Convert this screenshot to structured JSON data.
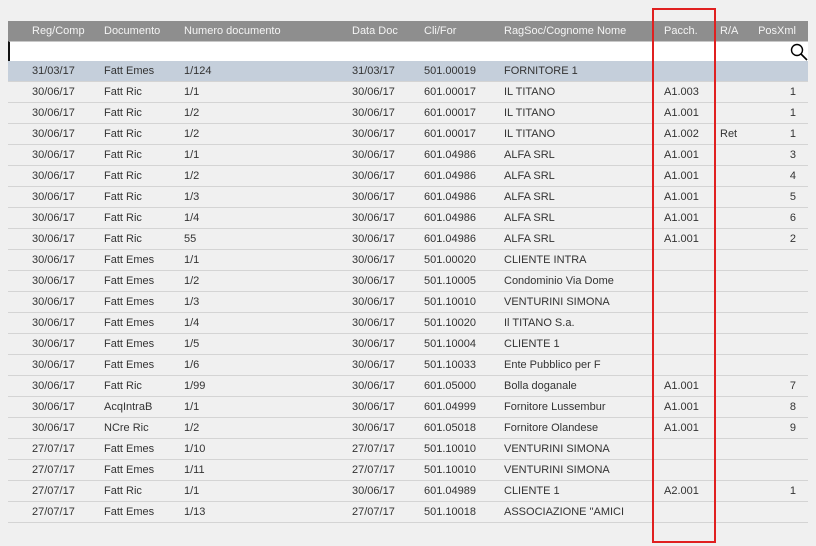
{
  "columns": [
    "Reg/Comp",
    "Documento",
    "Numero documento",
    "Data Doc",
    "Cli/For",
    "RagSoc/Cognome Nome",
    "Pacch.",
    "R/A",
    "PosXml"
  ],
  "search": {
    "value": "",
    "icon": "search-icon"
  },
  "highlight": {
    "column": "Pacch.",
    "color": "#e02020"
  },
  "selected_row": 0,
  "rows": [
    [
      "31/03/17",
      "Fatt Emes",
      "1/124",
      "31/03/17",
      "501.00019",
      "FORNITORE 1",
      "",
      "",
      ""
    ],
    [
      "30/06/17",
      "Fatt Ric",
      "1/1",
      "30/06/17",
      "601.00017",
      "IL TITANO",
      "A1.003",
      "",
      "1"
    ],
    [
      "30/06/17",
      "Fatt Ric",
      "1/2",
      "30/06/17",
      "601.00017",
      "IL TITANO",
      "A1.001",
      "",
      "1"
    ],
    [
      "30/06/17",
      "Fatt Ric",
      "1/2",
      "30/06/17",
      "601.00017",
      "IL TITANO",
      "A1.002",
      "Ret",
      "1"
    ],
    [
      "30/06/17",
      "Fatt Ric",
      "1/1",
      "30/06/17",
      "601.04986",
      "ALFA SRL",
      "A1.001",
      "",
      "3"
    ],
    [
      "30/06/17",
      "Fatt Ric",
      "1/2",
      "30/06/17",
      "601.04986",
      "ALFA SRL",
      "A1.001",
      "",
      "4"
    ],
    [
      "30/06/17",
      "Fatt Ric",
      "1/3",
      "30/06/17",
      "601.04986",
      "ALFA SRL",
      "A1.001",
      "",
      "5"
    ],
    [
      "30/06/17",
      "Fatt Ric",
      "1/4",
      "30/06/17",
      "601.04986",
      "ALFA SRL",
      "A1.001",
      "",
      "6"
    ],
    [
      "30/06/17",
      "Fatt Ric",
      "55",
      "30/06/17",
      "601.04986",
      "ALFA SRL",
      "A1.001",
      "",
      "2"
    ],
    [
      "30/06/17",
      "Fatt Emes",
      "1/1",
      "30/06/17",
      "501.00020",
      "CLIENTE INTRA",
      "",
      "",
      ""
    ],
    [
      "30/06/17",
      "Fatt Emes",
      "1/2",
      "30/06/17",
      "501.10005",
      "Condominio Via Dome",
      "",
      "",
      ""
    ],
    [
      "30/06/17",
      "Fatt Emes",
      "1/3",
      "30/06/17",
      "501.10010",
      "VENTURINI SIMONA",
      "",
      "",
      ""
    ],
    [
      "30/06/17",
      "Fatt Emes",
      "1/4",
      "30/06/17",
      "501.10020",
      "Il TITANO S.a.",
      "",
      "",
      ""
    ],
    [
      "30/06/17",
      "Fatt Emes",
      "1/5",
      "30/06/17",
      "501.10004",
      "CLIENTE 1",
      "",
      "",
      ""
    ],
    [
      "30/06/17",
      "Fatt Emes",
      "1/6",
      "30/06/17",
      "501.10033",
      "Ente Pubblico per F",
      "",
      "",
      ""
    ],
    [
      "30/06/17",
      "Fatt Ric",
      "1/99",
      "30/06/17",
      "601.05000",
      "Bolla doganale",
      "A1.001",
      "",
      "7"
    ],
    [
      "30/06/17",
      "AcqIntraB",
      "1/1",
      "30/06/17",
      "601.04999",
      "Fornitore Lussembur",
      "A1.001",
      "",
      "8"
    ],
    [
      "30/06/17",
      "NCre Ric",
      "1/2",
      "30/06/17",
      "601.05018",
      "Fornitore Olandese",
      "A1.001",
      "",
      "9"
    ],
    [
      "27/07/17",
      "Fatt Emes",
      "1/10",
      "27/07/17",
      "501.10010",
      "VENTURINI SIMONA",
      "",
      "",
      ""
    ],
    [
      "27/07/17",
      "Fatt Emes",
      "1/11",
      "27/07/17",
      "501.10010",
      "VENTURINI SIMONA",
      "",
      "",
      ""
    ],
    [
      "27/07/17",
      "Fatt Ric",
      "1/1",
      "30/06/17",
      "601.04989",
      "CLIENTE 1",
      "A2.001",
      "",
      "1"
    ],
    [
      "27/07/17",
      "Fatt Emes",
      "1/13",
      "27/07/17",
      "501.10018",
      "ASSOCIAZIONE \"AMICI",
      "",
      "",
      ""
    ]
  ]
}
